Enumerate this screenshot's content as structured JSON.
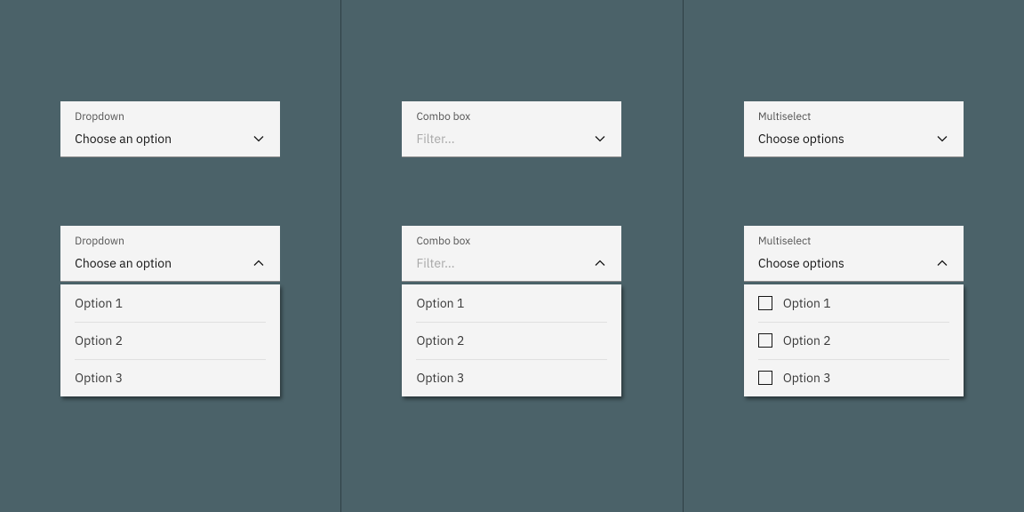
{
  "dropdown": {
    "label": "Dropdown",
    "value": "Choose an option",
    "options": [
      "Option 1",
      "Option 2",
      "Option 3"
    ]
  },
  "combobox": {
    "label": "Combo box",
    "placeholder": "Filter...",
    "options": [
      "Option 1",
      "Option 2",
      "Option 3"
    ]
  },
  "multiselect": {
    "label": "Multiselect",
    "value": "Choose options",
    "options": [
      "Option 1",
      "Option 2",
      "Option 3"
    ]
  }
}
